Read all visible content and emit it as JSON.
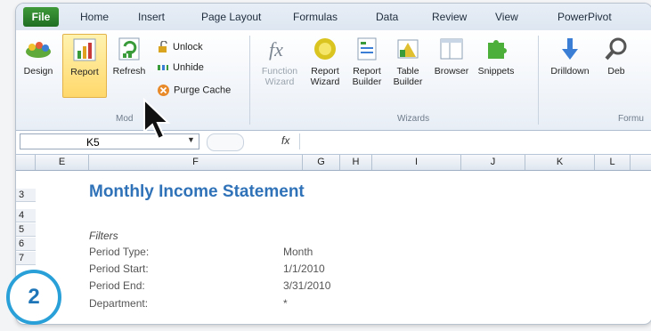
{
  "ribbon": {
    "tabs": [
      "File",
      "Home",
      "Insert",
      "Page Layout",
      "Formulas",
      "Data",
      "Review",
      "View",
      "PowerPivot"
    ],
    "model_group": {
      "label": "Mod",
      "buttons": [
        "Design",
        "Report",
        "Refresh"
      ],
      "small_buttons": [
        "Unlock",
        "Unhide",
        "Purge Cache"
      ]
    },
    "wizards_group": {
      "label": "Wizards",
      "buttons": [
        {
          "line1": "Function",
          "line2": "Wizard",
          "disabled": true
        },
        {
          "line1": "Report",
          "line2": "Wizard",
          "disabled": false
        },
        {
          "line1": "Report",
          "line2": "Builder",
          "disabled": false
        },
        {
          "line1": "Table",
          "line2": "Builder",
          "disabled": false
        },
        {
          "line1": "Browser",
          "line2": "",
          "disabled": false
        },
        {
          "line1": "Snippets",
          "line2": "",
          "disabled": false
        }
      ]
    },
    "formulas_group": {
      "label": "Formu",
      "buttons": [
        "Drilldown",
        "Deb"
      ]
    }
  },
  "formula_bar": {
    "name_box": "K5",
    "fx_label": "fx"
  },
  "columns": [
    "E",
    "F",
    "G",
    "H",
    "I",
    "J",
    "K",
    "L"
  ],
  "rows": [
    "3",
    "4",
    "5",
    "6",
    "7"
  ],
  "sheet": {
    "title": "Monthly Income Statement",
    "filters_label": "Filters",
    "fields": [
      {
        "label": "Period Type:",
        "value": "Month"
      },
      {
        "label": "Period Start:",
        "value": "1/1/2010"
      },
      {
        "label": "Period End:",
        "value": "3/31/2010"
      },
      {
        "label": "Department:",
        "value": "*"
      }
    ]
  },
  "step_badge": "2"
}
